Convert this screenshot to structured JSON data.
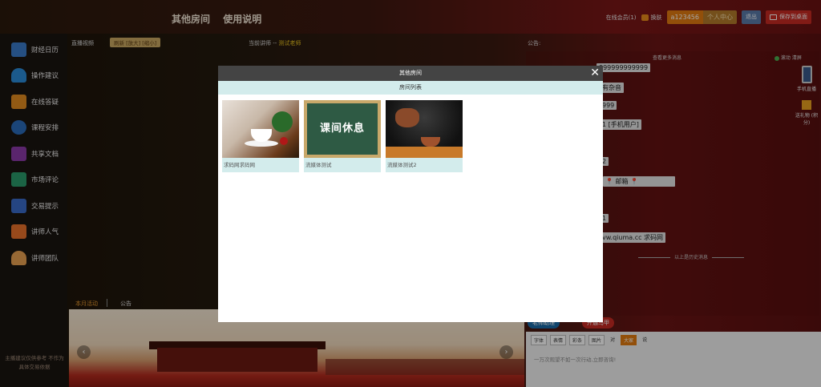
{
  "header": {
    "nav": [
      "其他房间",
      "使用说明"
    ],
    "online_label": "在线会员(1)",
    "skin_label": "换肤",
    "username": "a123456",
    "user_center": "个人中心",
    "logout": "退出",
    "save_desktop": "保存到桌面"
  },
  "sidebar": {
    "items": [
      {
        "label": "财经日历",
        "icon": "calendar-list-icon",
        "color": "#3a7ac8"
      },
      {
        "label": "操作建议",
        "icon": "bell-icon",
        "color": "#2a8ad8"
      },
      {
        "label": "在线答疑",
        "icon": "document-icon",
        "color": "#e08a20"
      },
      {
        "label": "课程安排",
        "icon": "person-chart-icon",
        "color": "#2a6ab8"
      },
      {
        "label": "共享文档",
        "icon": "line-chart-icon",
        "color": "#8a3aa8"
      },
      {
        "label": "市场评论",
        "icon": "books-icon",
        "color": "#2a9a6a"
      },
      {
        "label": "交易提示",
        "icon": "mail-icon",
        "color": "#3a6ac8"
      },
      {
        "label": "讲师人气",
        "icon": "thumbs-up-icon",
        "color": "#e8702a"
      },
      {
        "label": "讲师团队",
        "icon": "user-icon",
        "color": "#e8a050"
      }
    ],
    "footer": "主播建议仅供参考 不作为 具体交易依据"
  },
  "video": {
    "live_label": "直播视频",
    "refresh_label": "刷新 [放大] [缩小]",
    "lecturer_prefix": "当前讲师 -- ",
    "lecturer_name": "测试老师"
  },
  "tabs": {
    "monthly": "本月活动",
    "notice": "公告"
  },
  "chat": {
    "announcement_label": "公告:",
    "more_history": "查看更多消息",
    "scroll_label": "滚动",
    "clear_label": "清屏",
    "messages": [
      "999999999999",
      "有杂音",
      "999",
      "1 [手机用户]",
      "2",
      "📍 邮箱 📍",
      "1",
      "vw.qiuma.cc 求码网"
    ],
    "history_line": "以上是历史消息",
    "mobile_label": "手机直播",
    "gift_label": "送礼物 (积分)",
    "teacher_btn": "老师助理",
    "open_btn": "开通马甲",
    "tools": [
      "字体",
      "表情",
      "彩条",
      "图片",
      "对",
      "大家",
      "说"
    ],
    "placeholder": "一万次观望不如一次行动,立即咨询!"
  },
  "modal": {
    "title": "其他房间",
    "list_title": "房间列表",
    "rooms": [
      {
        "name": "求码网求码网",
        "image": "coffee-books-image"
      },
      {
        "name": "流媒体测试",
        "image": "chalkboard-break-image",
        "board_text": "课间休息"
      },
      {
        "name": "流媒体测试2",
        "image": "teapot-pouring-image"
      }
    ]
  }
}
